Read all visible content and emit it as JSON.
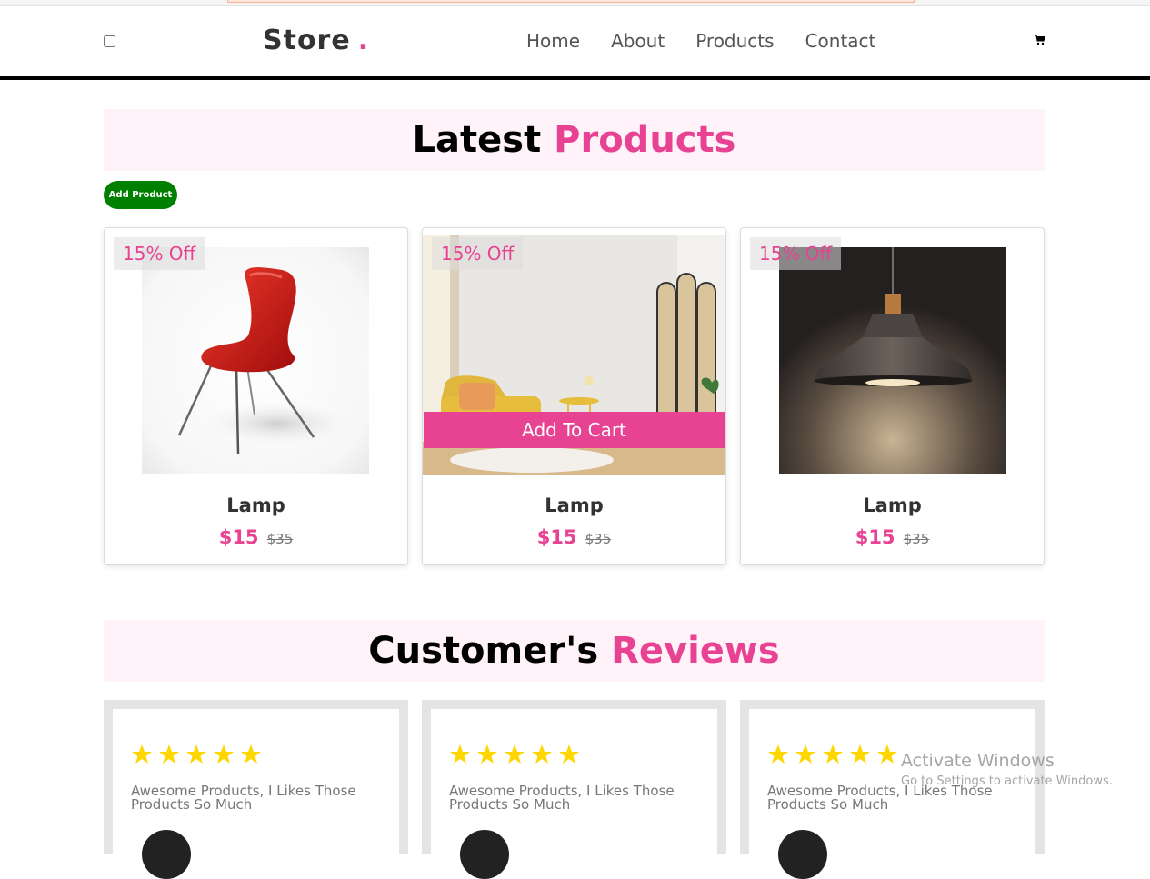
{
  "header": {
    "logo": "Store",
    "logo_dot": ".",
    "nav": [
      "Home",
      "About",
      "Products",
      "Contact"
    ],
    "cart_icon": "cart-icon"
  },
  "products_section": {
    "title_plain": "Latest",
    "title_accent": "Products",
    "add_button": "Add Product",
    "items": [
      {
        "discount": "15% Off",
        "name": "Lamp",
        "price": "$15",
        "old_price": "$35",
        "image": "red-chair"
      },
      {
        "discount": "15% Off",
        "name": "Lamp",
        "price": "$15",
        "old_price": "$35",
        "image": "living-room",
        "add_to_cart": "Add To Cart"
      },
      {
        "discount": "15% Off",
        "name": "Lamp",
        "price": "$15",
        "old_price": "$35",
        "image": "pendant-lamp"
      }
    ]
  },
  "reviews_section": {
    "title_plain": "Customer's",
    "title_accent": "Reviews",
    "items": [
      {
        "stars": 5,
        "text": "Awesome Products, I Likes Those Products So Much"
      },
      {
        "stars": 5,
        "text": "Awesome Products, I Likes Those Products So Much"
      },
      {
        "stars": 5,
        "text": "Awesome Products, I Likes Those Products So Much"
      }
    ]
  },
  "watermark": {
    "line1": "Activate Windows",
    "line2": "Go to Settings to activate Windows."
  },
  "colors": {
    "accent": "#e84393",
    "add_button": "#008000",
    "star": "#ffd700"
  }
}
